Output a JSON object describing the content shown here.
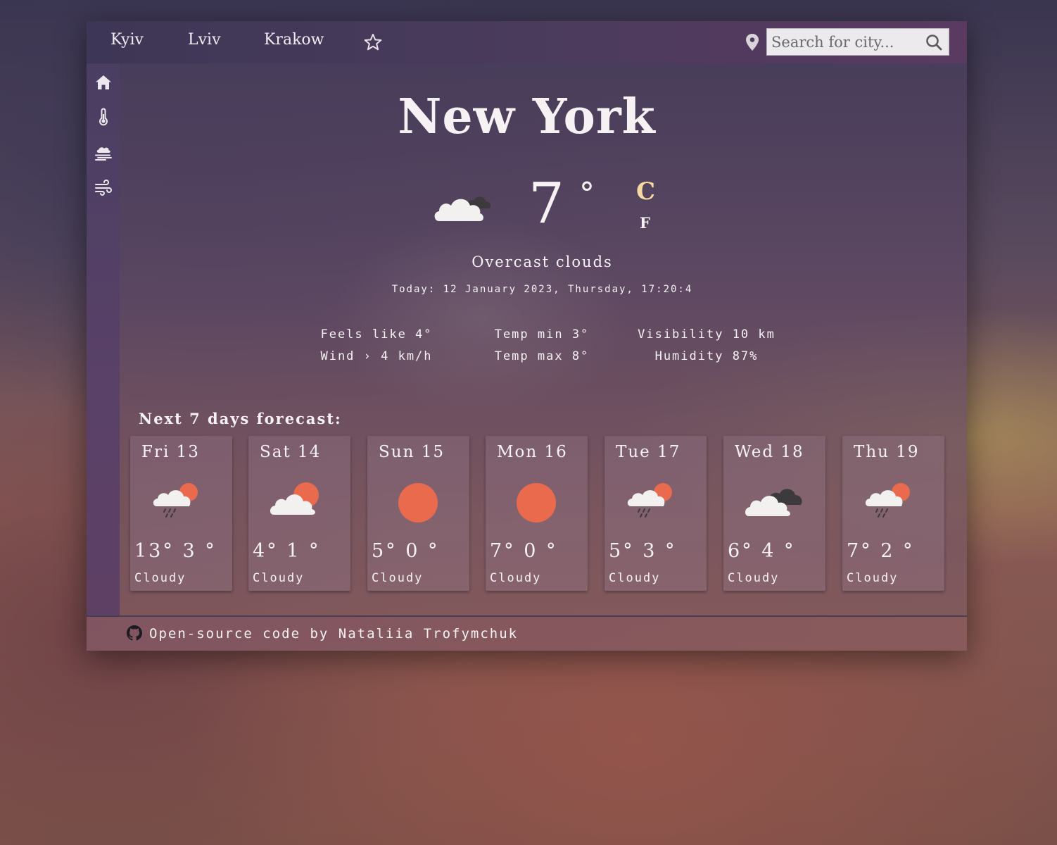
{
  "nav": {
    "cities": [
      "Kyiv",
      "Lviv",
      "Krakow"
    ],
    "favorites_icon": "star-outline-icon",
    "location_icon": "map-pin-icon"
  },
  "search": {
    "placeholder": "Search for city...",
    "value": "",
    "icon": "magnifier-icon"
  },
  "sidebar": {
    "items": [
      {
        "icon": "home-icon"
      },
      {
        "icon": "thermometer-icon"
      },
      {
        "icon": "fog-icon"
      },
      {
        "icon": "wind-icon"
      }
    ]
  },
  "current": {
    "city": "New York",
    "icon": "cloud-icon",
    "temperature": "7",
    "degree_symbol": "°",
    "unit_c": "C",
    "unit_f": "F",
    "active_unit": "C",
    "description": "Overcast clouds",
    "date": "Today: 12 January 2023, Thursday, 17:20:4",
    "details": {
      "feels_like": "Feels like 4°",
      "wind": "Wind › 4 km/h",
      "temp_min": "Temp min 3°",
      "temp_max": "Temp max 8°",
      "visibility": "Visibility 10 km",
      "humidity": "Humidity 87%"
    }
  },
  "forecast": {
    "title": "Next 7 days forecast:",
    "days": [
      {
        "name": "Fri 13",
        "icon": "rain-sun-icon",
        "temps": "13° 3 °",
        "desc": "Cloudy"
      },
      {
        "name": "Sat 14",
        "icon": "cloud-sun-icon",
        "temps": "4° 1 °",
        "desc": "Cloudy"
      },
      {
        "name": "Sun 15",
        "icon": "sun-icon",
        "temps": "5° 0 °",
        "desc": "Cloudy"
      },
      {
        "name": "Mon 16",
        "icon": "sun-icon",
        "temps": "7° 0 °",
        "desc": "Cloudy"
      },
      {
        "name": "Tue 17",
        "icon": "rain-sun-icon",
        "temps": "5° 3 °",
        "desc": "Cloudy"
      },
      {
        "name": "Wed 18",
        "icon": "overcast-icon",
        "temps": "6° 4 °",
        "desc": "Cloudy"
      },
      {
        "name": "Thu 19",
        "icon": "rain-sun-icon",
        "temps": "7° 2 °",
        "desc": "Cloudy"
      }
    ]
  },
  "footer": {
    "icon": "github-icon",
    "text": "Open-source code by Nataliia Trofymchuk"
  },
  "colors": {
    "sun": "#ea6a4e",
    "active_unit": "#f5d9a0",
    "cloud": "#f2f1f0",
    "dark_cloud": "#3d3a3d"
  }
}
